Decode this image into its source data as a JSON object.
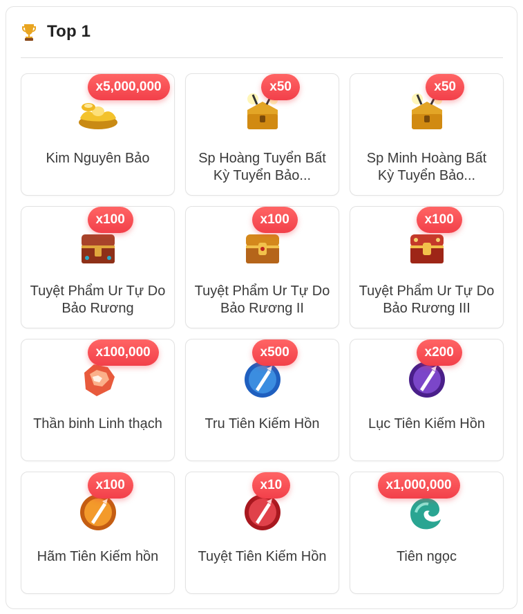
{
  "header": {
    "title": "Top 1",
    "icon": "trophy-icon"
  },
  "colors": {
    "badge": "#f2404a",
    "text": "#3a3a3a",
    "border": "#e2e2e2"
  },
  "items": [
    {
      "name": "Kim Nguyên Bảo",
      "qty": "x5,000,000",
      "icon": "gold-ingot-icon"
    },
    {
      "name": "Sp Hoàng Tuyển Bất Kỳ Tuyển Bảo...",
      "qty": "x50",
      "icon": "golden-chest-icon"
    },
    {
      "name": "Sp Minh Hoàng Bất Kỳ Tuyển Bảo...",
      "qty": "x50",
      "icon": "golden-chest-icon"
    },
    {
      "name": "Tuyệt Phẩm Ur Tự Do Bảo Rương",
      "qty": "x100",
      "icon": "treasure-chest-icon"
    },
    {
      "name": "Tuyệt Phẩm Ur Tự Do Bảo Rương II",
      "qty": "x100",
      "icon": "treasure-chest-icon"
    },
    {
      "name": "Tuyệt Phẩm Ur Tự Do Bảo Rương III",
      "qty": "x100",
      "icon": "treasure-chest-icon"
    },
    {
      "name": "Thần binh Linh thạch",
      "qty": "x100,000",
      "icon": "spirit-stone-icon"
    },
    {
      "name": "Tru Tiên Kiếm Hồn",
      "qty": "x500",
      "icon": "sword-soul-blue-icon"
    },
    {
      "name": "Lục Tiên Kiếm Hồn",
      "qty": "x200",
      "icon": "sword-soul-purple-icon"
    },
    {
      "name": "Hãm Tiên Kiếm hồn",
      "qty": "x100",
      "icon": "sword-soul-orange-icon"
    },
    {
      "name": "Tuyệt Tiên Kiếm Hồn",
      "qty": "x10",
      "icon": "sword-soul-red-icon"
    },
    {
      "name": "Tiên ngọc",
      "qty": "x1,000,000",
      "icon": "jade-icon"
    }
  ]
}
